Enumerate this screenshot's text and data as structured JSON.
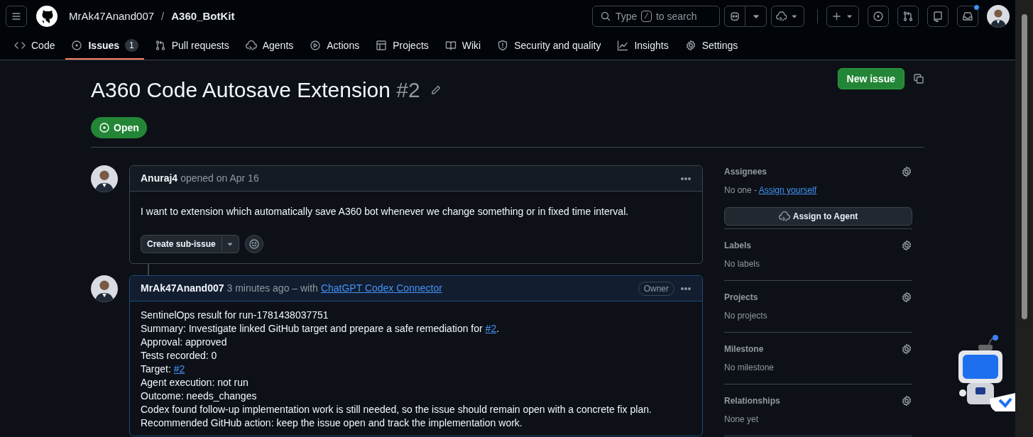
{
  "header": {
    "owner": "MrAk47Anand007",
    "separator": "/",
    "repo": "A360_BotKit",
    "search": {
      "before": "Type",
      "key": "/",
      "after": "to search"
    },
    "inbox_unread": true
  },
  "tabs": [
    {
      "label": "Code",
      "selected": false
    },
    {
      "label": "Issues",
      "counter": "1",
      "selected": true
    },
    {
      "label": "Pull requests",
      "selected": false
    },
    {
      "label": "Agents",
      "selected": false
    },
    {
      "label": "Actions",
      "selected": false
    },
    {
      "label": "Projects",
      "selected": false
    },
    {
      "label": "Wiki",
      "selected": false
    },
    {
      "label": "Security and quality",
      "selected": false
    },
    {
      "label": "Insights",
      "selected": false
    },
    {
      "label": "Settings",
      "selected": false
    }
  ],
  "issue": {
    "title": "A360 Code Autosave Extension",
    "number": "#2",
    "state": "Open",
    "new_button": "New issue"
  },
  "comments": [
    {
      "kind": "author",
      "author": "Anuraj4",
      "meta": "opened on Apr 16",
      "lines": [
        {
          "text": "I want to extension which automatically save A360 bot whenever we change something or in fixed time interval."
        }
      ],
      "sub_issue_button": "Create sub-issue"
    },
    {
      "kind": "owner",
      "author": "MrAk47Anand007",
      "meta": "3 minutes ago – with",
      "via": "ChatGPT Codex Connector",
      "badge": "Owner",
      "lines": [
        {
          "text": "SentinelOps result for run-1781438037751"
        },
        {
          "text": "Summary: Investigate linked GitHub target and prepare a safe remediation for ",
          "link": "#2",
          "after": "."
        },
        {
          "text": "Approval: approved"
        },
        {
          "text": "Tests recorded: 0"
        },
        {
          "text": "Target: ",
          "link": "#2"
        },
        {
          "text": "Agent execution: not run"
        },
        {
          "text": "Outcome: needs_changes"
        },
        {
          "text": "Codex found follow-up implementation work is still needed, so the issue should remain open with a concrete fix plan."
        },
        {
          "text": "Recommended GitHub action: keep the issue open and track the implementation work."
        }
      ]
    }
  ],
  "sidebar": [
    {
      "heading": "Assignees",
      "value": "No one - ",
      "link": "Assign yourself",
      "button": "Assign to Agent"
    },
    {
      "heading": "Labels",
      "value": "No labels"
    },
    {
      "heading": "Projects",
      "value": "No projects"
    },
    {
      "heading": "Milestone",
      "value": "No milestone"
    },
    {
      "heading": "Relationships",
      "value": "None yet"
    }
  ]
}
